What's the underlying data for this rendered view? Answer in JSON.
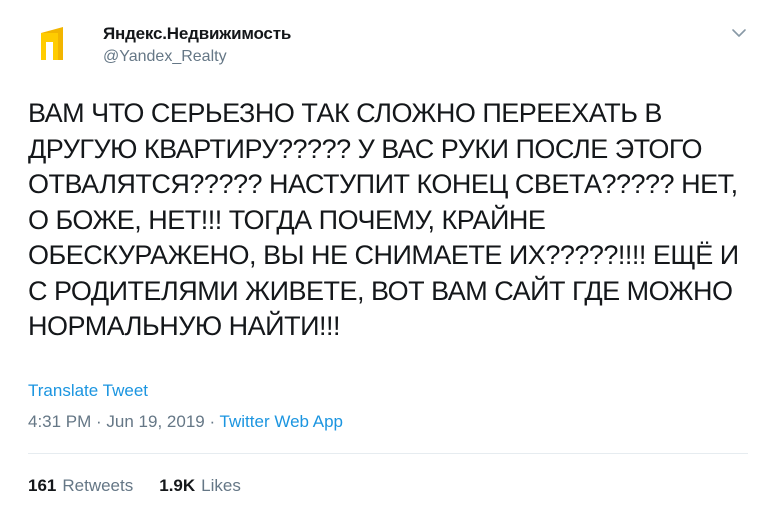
{
  "account": {
    "display_name": "Яндекс.Недвижимость",
    "handle": "@Yandex_Realty",
    "avatar_icon": "yandex-realty-logo-icon",
    "brand_color": "#f8c100"
  },
  "tweet": {
    "text": "ВАМ ЧТО СЕРЬЕЗНО ТАК СЛОЖНО ПЕРЕЕХАТЬ В ДРУГУЮ КВАРТИРУ????? У ВАС РУКИ ПОСЛЕ ЭТОГО ОТВАЛЯТСЯ????? НАСТУПИТ КОНЕЦ СВЕТА????? НЕТ, О БОЖЕ, НЕТ!!! ТОГДА ПОЧЕМУ, КРАЙНЕ ОБЕСКУРАЖЕНО, ВЫ НЕ СНИМАЕТЕ ИХ?????!!!! ЕЩЁ И С РОДИТЕЛЯМИ ЖИВЕТЕ, ВОТ ВАМ САЙТ ГДЕ МОЖНО НОРМАЛЬНУЮ НАЙТИ!!!",
    "translate_label": "Translate Tweet",
    "time": "4:31 PM",
    "sep": " · ",
    "date": "Jun 19, 2019",
    "app": "Twitter Web App"
  },
  "stats": {
    "retweets_count": "161",
    "retweets_label": "Retweets",
    "likes_count": "1.9K",
    "likes_label": "Likes"
  },
  "colors": {
    "link": "#1b95e0",
    "secondary": "#657786",
    "text": "#14171a"
  }
}
